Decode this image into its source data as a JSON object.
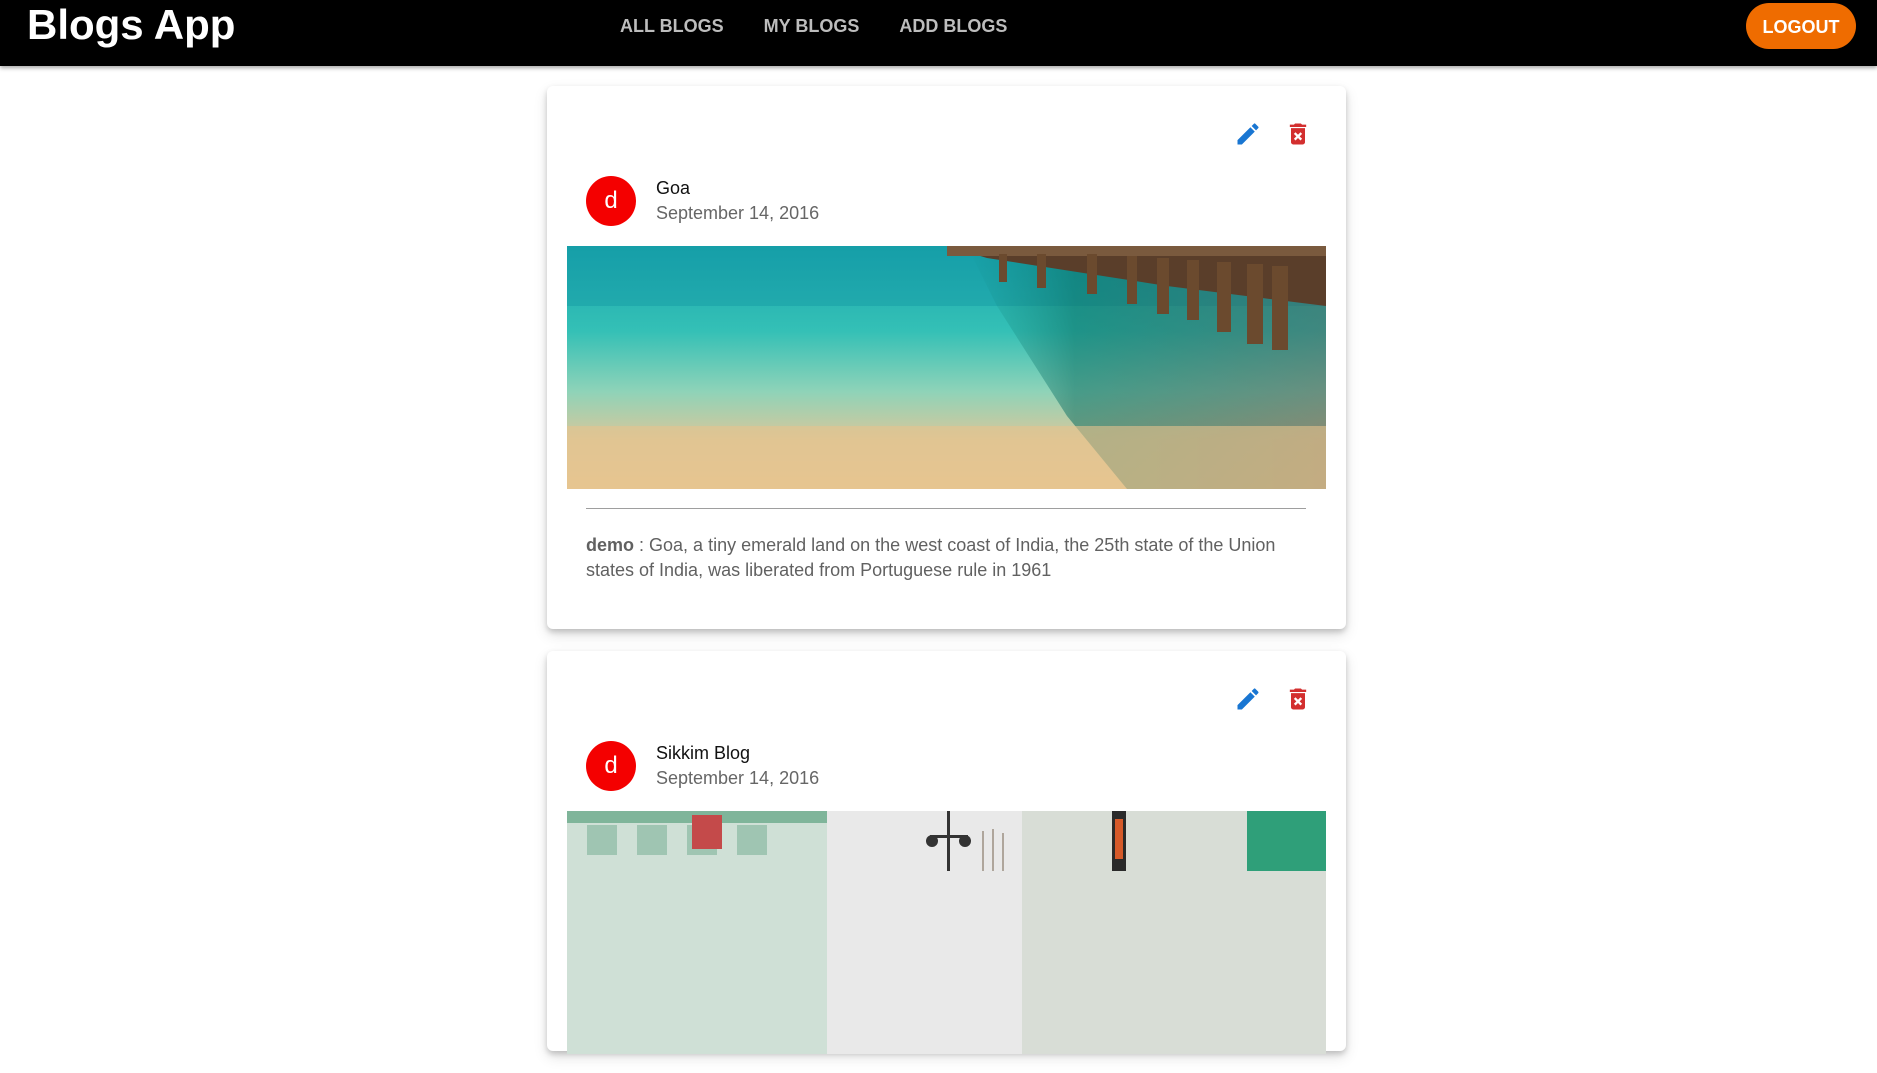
{
  "app": {
    "title": "Blogs App",
    "nav_tabs": [
      {
        "label": "ALL BLOGS"
      },
      {
        "label": "MY BLOGS"
      },
      {
        "label": "ADD BLOGS"
      }
    ],
    "logout_label": "LOGOUT",
    "colors": {
      "appbar": "#000000",
      "logout": "#ef6c00",
      "avatar": "#f40000",
      "edit_icon": "#1976d2",
      "delete_icon": "#d32f2f"
    }
  },
  "blogs": [
    {
      "avatar_letter": "d",
      "title": "Goa",
      "date": "September 14, 2016",
      "user": "demo",
      "separator": " : ",
      "description": "Goa, a tiny emerald land on the west coast of India, the 25th state of the Union states of India, was liberated from Portuguese rule in 1961"
    },
    {
      "avatar_letter": "d",
      "title": "Sikkim Blog",
      "date": "September 14, 2016"
    }
  ]
}
